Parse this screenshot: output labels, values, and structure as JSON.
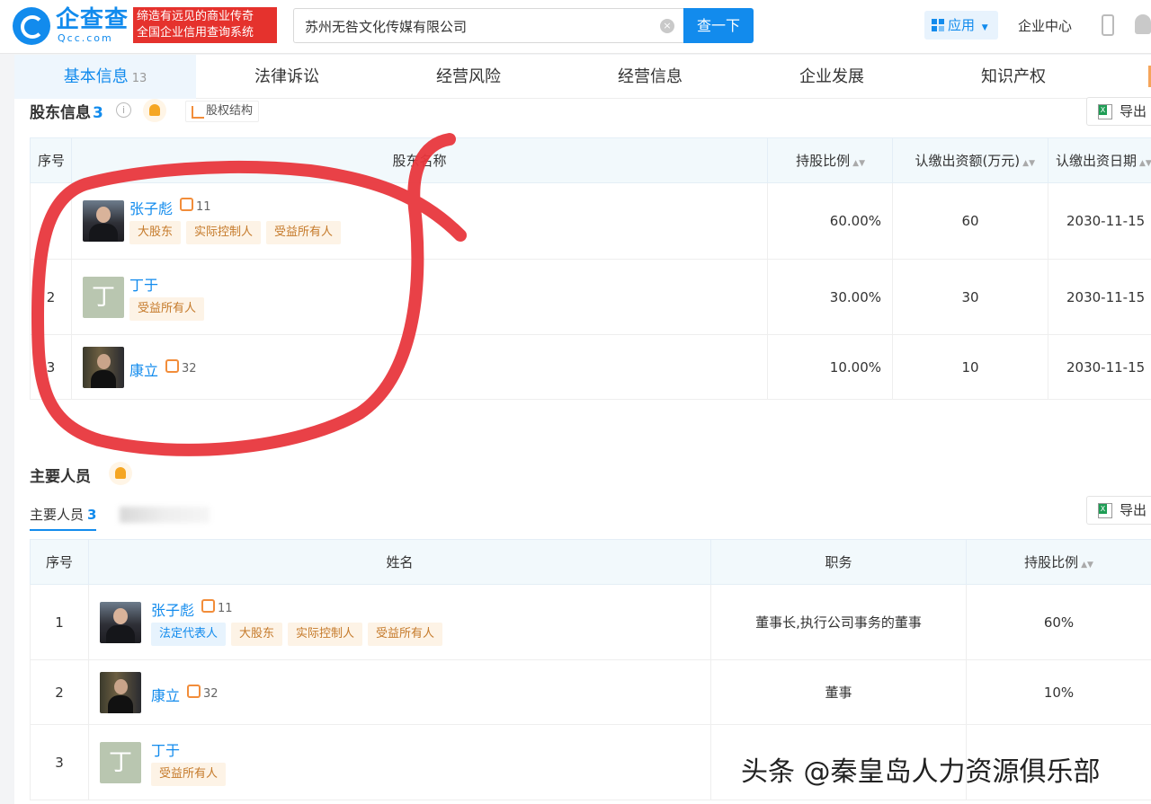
{
  "header": {
    "logo_name": "企查查",
    "logo_sub": "Qcc.com",
    "slogan_line1": "缔造有远见的商业传奇",
    "slogan_line2": "全国企业信用查询系统",
    "search_value": "苏州无咎文化传媒有限公司",
    "search_button": "查一下",
    "app_button": "应用",
    "enterprise_center": "企业中心"
  },
  "tabs": [
    {
      "label": "基本信息",
      "count": "13"
    },
    {
      "label": "法律诉讼"
    },
    {
      "label": "经营风险"
    },
    {
      "label": "经营信息"
    },
    {
      "label": "企业发展"
    },
    {
      "label": "知识产权"
    }
  ],
  "shareholders": {
    "title": "股东信息",
    "count": "3",
    "equity_button": "股权结构",
    "export_label": "导出",
    "columns": [
      "序号",
      "股东名称",
      "持股比例",
      "认缴出资额(万元)",
      "认缴出资日期"
    ],
    "rows": [
      {
        "index": "",
        "name": "张子彪",
        "rel_count": "11",
        "tags": [
          "大股东",
          "实际控制人",
          "受益所有人"
        ],
        "ratio": "60.00%",
        "amount": "60",
        "date": "2030-11-15",
        "avatar": "photo"
      },
      {
        "index": "2",
        "name": "丁于",
        "rel_count": "",
        "tags": [
          "受益所有人"
        ],
        "ratio": "30.00%",
        "amount": "30",
        "date": "2030-11-15",
        "avatar": "letter",
        "avatar_letter": "丁"
      },
      {
        "index": "3",
        "name": "康立",
        "rel_count": "32",
        "tags": [],
        "ratio": "10.00%",
        "amount": "10",
        "date": "2030-11-15",
        "avatar": "photo2"
      }
    ]
  },
  "personnel": {
    "title": "主要人员",
    "subtab_label": "主要人员",
    "subtab_count": "3",
    "export_label": "导出",
    "columns": [
      "序号",
      "姓名",
      "职务",
      "持股比例"
    ],
    "rows": [
      {
        "index": "1",
        "name": "张子彪",
        "rel_count": "11",
        "tags": [
          {
            "text": "法定代表人",
            "style": "blue"
          },
          {
            "text": "大股东"
          },
          {
            "text": "实际控制人"
          },
          {
            "text": "受益所有人"
          }
        ],
        "position": "董事长,执行公司事务的董事",
        "ratio": "60%",
        "avatar": "photo"
      },
      {
        "index": "2",
        "name": "康立",
        "rel_count": "32",
        "tags": [],
        "position": "董事",
        "ratio": "10%",
        "avatar": "photo2"
      },
      {
        "index": "3",
        "name": "丁于",
        "rel_count": "",
        "tags": [
          {
            "text": "受益所有人"
          }
        ],
        "position": "",
        "ratio": "",
        "avatar": "letter",
        "avatar_letter": "丁"
      }
    ]
  },
  "watermark": "头条 @秦皇岛人力资源俱乐部",
  "colors": {
    "brand": "#128bed",
    "slogan_bg": "#e5322d",
    "annotation": "#e8373d"
  }
}
